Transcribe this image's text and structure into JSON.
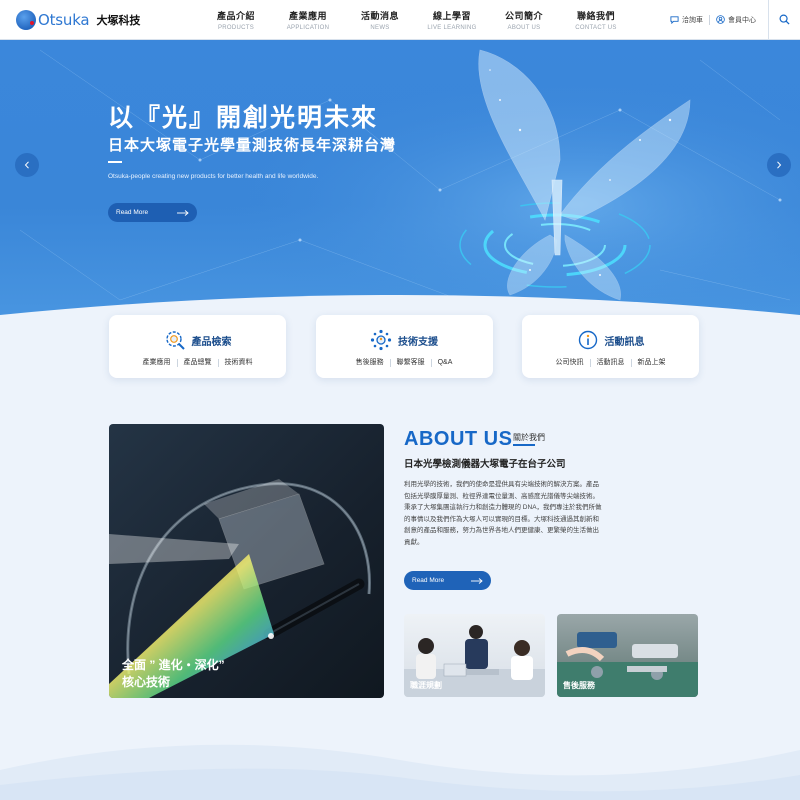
{
  "brand": {
    "logo_text": "Otsuka",
    "name_zh": "大塚科技"
  },
  "nav": [
    {
      "zh": "產品介紹",
      "en": "PRODUCTS"
    },
    {
      "zh": "產業應用",
      "en": "APPLICATION"
    },
    {
      "zh": "活動消息",
      "en": "NEWS"
    },
    {
      "zh": "線上學習",
      "en": "LIVE LEARNING"
    },
    {
      "zh": "公司簡介",
      "en": "ABOUT US"
    },
    {
      "zh": "聯絡我們",
      "en": "CONTACT US"
    }
  ],
  "header_links": {
    "inquiry": "洽詢車",
    "member": "會員中心"
  },
  "hero": {
    "title": "以『光』開創光明未來",
    "subtitle": "日本大塚電子光學量測技術長年深耕台灣",
    "tagline": "Otsuka-people creating new products for better health and life worldwide.",
    "read_more": "Read More"
  },
  "cards": [
    {
      "title": "產品檢索",
      "icon": "magnifier-icon",
      "links": [
        "產業應用",
        "產品總覽",
        "技術資料"
      ]
    },
    {
      "title": "技術支援",
      "icon": "support-network-icon",
      "links": [
        "售後服務",
        "聯繫客服",
        "Q&A"
      ]
    },
    {
      "title": "活動訊息",
      "icon": "info-icon",
      "links": [
        "公司快訊",
        "活動訊息",
        "新品上架"
      ]
    }
  ],
  "about": {
    "heading": "ABOUT US",
    "heading_zh": "關於我們",
    "subheading": "日本光學檢測儀器大塚電子在台子公司",
    "paragraphs": [
      "利用光學的技術，我們的使命是提供具有尖端技術的解決方案。產品包括光學膜厚量測、粒徑界達電位量測、高感度光譜儀等尖端技術。",
      "秉承了大塚集團這執行力和創造力體現的 DNA，我們專注於我們所做的事情以及我們作為大塚人可以實現的目標。大塚科技通過其創新和創意的產品和服務，努力為世界各地人們更健康、更繁榮的生活做出貢獻。"
    ],
    "image_caption_line1": "全面 ” 進化・深化”",
    "image_caption_line2": "核心技術",
    "read_more": "Read More",
    "tiles": [
      {
        "label": "職涯規劃"
      },
      {
        "label": "售後服務"
      }
    ]
  },
  "colors": {
    "primary": "#1768c7",
    "hero_bg": "#3a86d8",
    "page_bg": "#edf3fb",
    "dark_button": "#1e5fb3"
  }
}
